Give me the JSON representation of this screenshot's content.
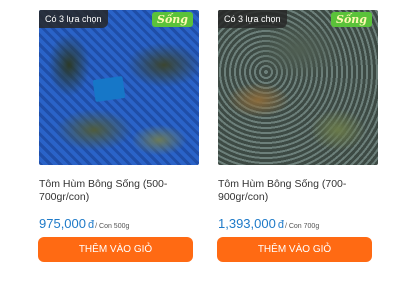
{
  "products": [
    {
      "options_badge": "Có 3 lựa chọn",
      "live_badge": "Sống",
      "name": "Tôm Hùm Bông Sống (500-700gr/con)",
      "price": "975,000",
      "currency": "đ",
      "per_unit": "/ Con 500g",
      "add_to_cart": "THÊM VÀO GIỎ"
    },
    {
      "options_badge": "Có 3 lựa chọn",
      "live_badge": "Sống",
      "name": "Tôm Hùm Bông Sống (700-900gr/con)",
      "price": "1,393,000",
      "currency": "đ",
      "per_unit": "/ Con 700g",
      "add_to_cart": "THÊM VÀO GIỎ"
    }
  ],
  "colors": {
    "price": "#1e7ac8",
    "button": "#ff6a13",
    "live_badge": "#5ac23a"
  }
}
